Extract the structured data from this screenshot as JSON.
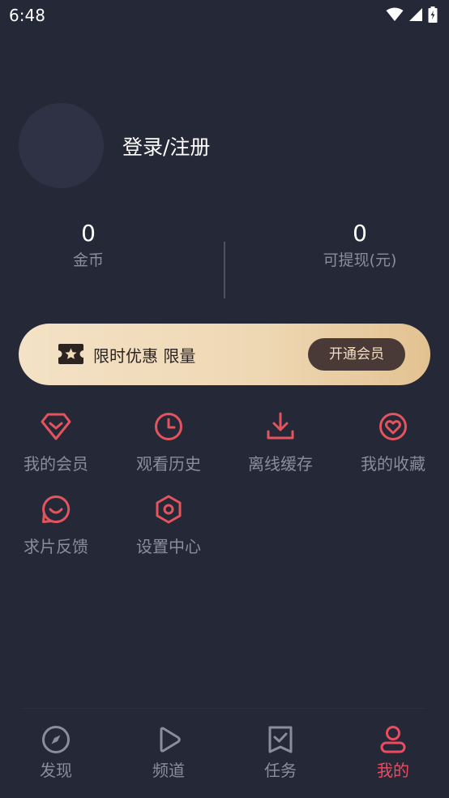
{
  "status_bar": {
    "time": "6:48"
  },
  "profile": {
    "login_label": "登录/注册"
  },
  "stats": {
    "coins": {
      "value": "0",
      "label": "金币"
    },
    "withdrawable": {
      "value": "0",
      "label": "可提现(元)"
    }
  },
  "vip_banner": {
    "text": "限时优惠 限量",
    "button_label": "开通会员"
  },
  "menu": {
    "items": [
      {
        "label": "我的会员",
        "icon": "diamond-icon"
      },
      {
        "label": "观看历史",
        "icon": "clock-icon"
      },
      {
        "label": "离线缓存",
        "icon": "download-icon"
      },
      {
        "label": "我的收藏",
        "icon": "heart-icon"
      },
      {
        "label": "求片反馈",
        "icon": "smile-chat-icon"
      },
      {
        "label": "设置中心",
        "icon": "settings-hexagon-icon"
      }
    ]
  },
  "tabs": [
    {
      "label": "发现",
      "icon": "compass-icon"
    },
    {
      "label": "频道",
      "icon": "play-icon"
    },
    {
      "label": "任务",
      "icon": "task-check-icon"
    },
    {
      "label": "我的",
      "icon": "user-icon",
      "active": true
    }
  ],
  "colors": {
    "background": "#252837",
    "accent": "#ef4a60",
    "icon_red": "#e2545e",
    "muted_text": "#8a8d9c",
    "vip_button": "#4a3a37"
  }
}
